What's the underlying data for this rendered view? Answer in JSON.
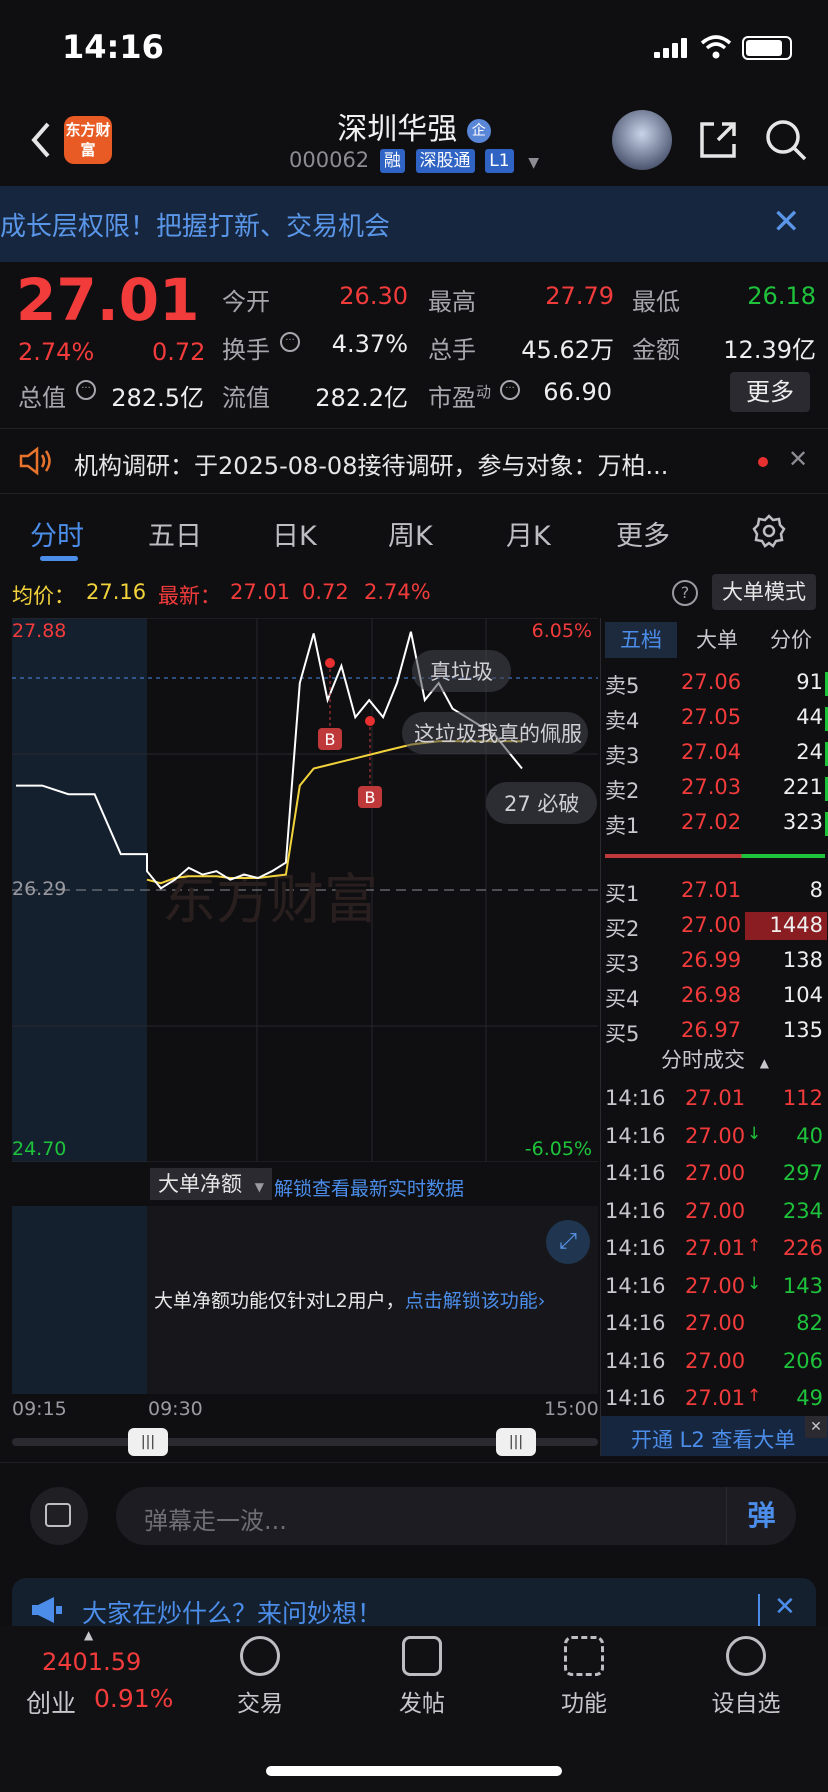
{
  "status_bar": {
    "time": "14:16"
  },
  "header": {
    "logo_text": "东方财富",
    "stock_name": "深圳华强",
    "code": "000062",
    "tags": [
      "融",
      "深股通",
      "L1"
    ],
    "badge": "企"
  },
  "banner": {
    "text": "成长层权限！把握打新、交易机会"
  },
  "quote": {
    "price": "27.01",
    "change_pct": "2.74%",
    "change": "0.72",
    "today_open_label": "今开",
    "today_open": "26.30",
    "high_label": "最高",
    "high": "27.79",
    "low_label": "最低",
    "low": "26.18",
    "turnover_label": "换手",
    "turnover": "4.37%",
    "volume_label": "总手",
    "volume": "45.62万",
    "amount_label": "金额",
    "amount": "12.39亿",
    "total_value_label": "总值",
    "total_value": "282.5亿",
    "float_value_label": "流值",
    "float_value": "282.2亿",
    "pe_label": "市盈",
    "pe_sup": "动",
    "pe": "66.90",
    "more_button": "更多"
  },
  "notice": {
    "text": "机构调研：于2025-08-08接待调研，参与对象：万柏..."
  },
  "tabs": [
    "分时",
    "五日",
    "日K",
    "周K",
    "月K",
    "更多"
  ],
  "price_line": {
    "avg_label": "均价：",
    "avg": "27.16",
    "latest_label": "最新：",
    "latest": "27.01",
    "latest_chg": "0.72",
    "latest_pct": "2.74%",
    "mode_button": "大单模式"
  },
  "chart": {
    "y_top": "27.88",
    "y_mid": "26.29",
    "y_bottom": "24.70",
    "pct_top": "6.05%",
    "pct_bottom": "-6.05%",
    "danmaku": [
      "真垃圾",
      "这垃圾我真的佩服",
      "27 必破"
    ],
    "trade_marker": "B",
    "watermark": "东方财富",
    "colors": {
      "price": "#ffffff",
      "avg": "#f2d33c",
      "ref": "#4b8de8"
    }
  },
  "chart_data": {
    "type": "line",
    "title": "",
    "x_labels": [
      "09:15",
      "09:30",
      "15:00"
    ],
    "ylim": [
      24.7,
      27.88
    ],
    "series": [
      {
        "name": "",
        "values": [
          26.9,
          26.9,
          26.85,
          26.85,
          26.5,
          26.5,
          26.4,
          26.3,
          26.35,
          26.42,
          26.38,
          26.4,
          26.35,
          26.38,
          26.36,
          26.4,
          26.45,
          27.5,
          27.79,
          27.4,
          27.6,
          27.3,
          27.4,
          27.3,
          27.5,
          27.8,
          27.4,
          27.5,
          27.35,
          27.3,
          27.25,
          27.2,
          27.1,
          27.0
        ]
      },
      {
        "name": "",
        "values": [
          null,
          null,
          null,
          null,
          null,
          null,
          26.35,
          26.33,
          26.36,
          26.37,
          26.37,
          26.37,
          26.36,
          26.36,
          26.36,
          26.37,
          26.38,
          26.9,
          27.0,
          27.02,
          27.04,
          27.06,
          27.08,
          27.1,
          27.12,
          27.14,
          27.15,
          27.16,
          27.16,
          27.16,
          27.16,
          27.16,
          27.16,
          27.16
        ]
      }
    ]
  },
  "sub_chart": {
    "dropdown": "大单净额",
    "unlock_link": "解锁查看最新实时数据",
    "message": "大单净额功能仅针对L2用户，",
    "message_link": "点击解锁该功能",
    "x_left": "09:15",
    "x_mid": "09:30",
    "x_right": "15:00"
  },
  "orderbook": {
    "tabs": [
      "五档",
      "大单",
      "分价"
    ],
    "asks": [
      {
        "label": "卖5",
        "price": "27.06",
        "vol": "91"
      },
      {
        "label": "卖4",
        "price": "27.05",
        "vol": "44"
      },
      {
        "label": "卖3",
        "price": "27.04",
        "vol": "24"
      },
      {
        "label": "卖2",
        "price": "27.03",
        "vol": "221"
      },
      {
        "label": "卖1",
        "price": "27.02",
        "vol": "323"
      }
    ],
    "bids": [
      {
        "label": "买1",
        "price": "27.01",
        "vol": "8"
      },
      {
        "label": "买2",
        "price": "27.00",
        "vol": "1448"
      },
      {
        "label": "买3",
        "price": "26.99",
        "vol": "138"
      },
      {
        "label": "买4",
        "price": "26.98",
        "vol": "104"
      },
      {
        "label": "买5",
        "price": "26.97",
        "vol": "135"
      }
    ],
    "trades_title": "分时成交",
    "trades": [
      {
        "time": "14:16",
        "price": "27.01",
        "arrow": "",
        "vol": "112",
        "side": "red"
      },
      {
        "time": "14:16",
        "price": "27.00",
        "arrow": "↓",
        "vol": "40",
        "side": "green"
      },
      {
        "time": "14:16",
        "price": "27.00",
        "arrow": "",
        "vol": "297",
        "side": "green"
      },
      {
        "time": "14:16",
        "price": "27.00",
        "arrow": "",
        "vol": "234",
        "side": "green"
      },
      {
        "time": "14:16",
        "price": "27.01",
        "arrow": "↑",
        "vol": "226",
        "side": "red"
      },
      {
        "time": "14:16",
        "price": "27.00",
        "arrow": "↓",
        "vol": "143",
        "side": "green"
      },
      {
        "time": "14:16",
        "price": "27.00",
        "arrow": "",
        "vol": "82",
        "side": "green"
      },
      {
        "time": "14:16",
        "price": "27.00",
        "arrow": "",
        "vol": "206",
        "side": "green"
      },
      {
        "time": "14:16",
        "price": "27.01",
        "arrow": "↑",
        "vol": "49",
        "side": "green"
      }
    ],
    "l2_button": "开通 L2 查看大单"
  },
  "comment": {
    "placeholder": "弹幕走一波...",
    "send": "弹"
  },
  "promo": {
    "text": "大家在炒什么？来问妙想！"
  },
  "bottom_nav": {
    "index_value": "2401.59",
    "index_name": "创业",
    "index_pct": "0.91%",
    "items": [
      "交易",
      "发帖",
      "功能",
      "设自选"
    ]
  }
}
